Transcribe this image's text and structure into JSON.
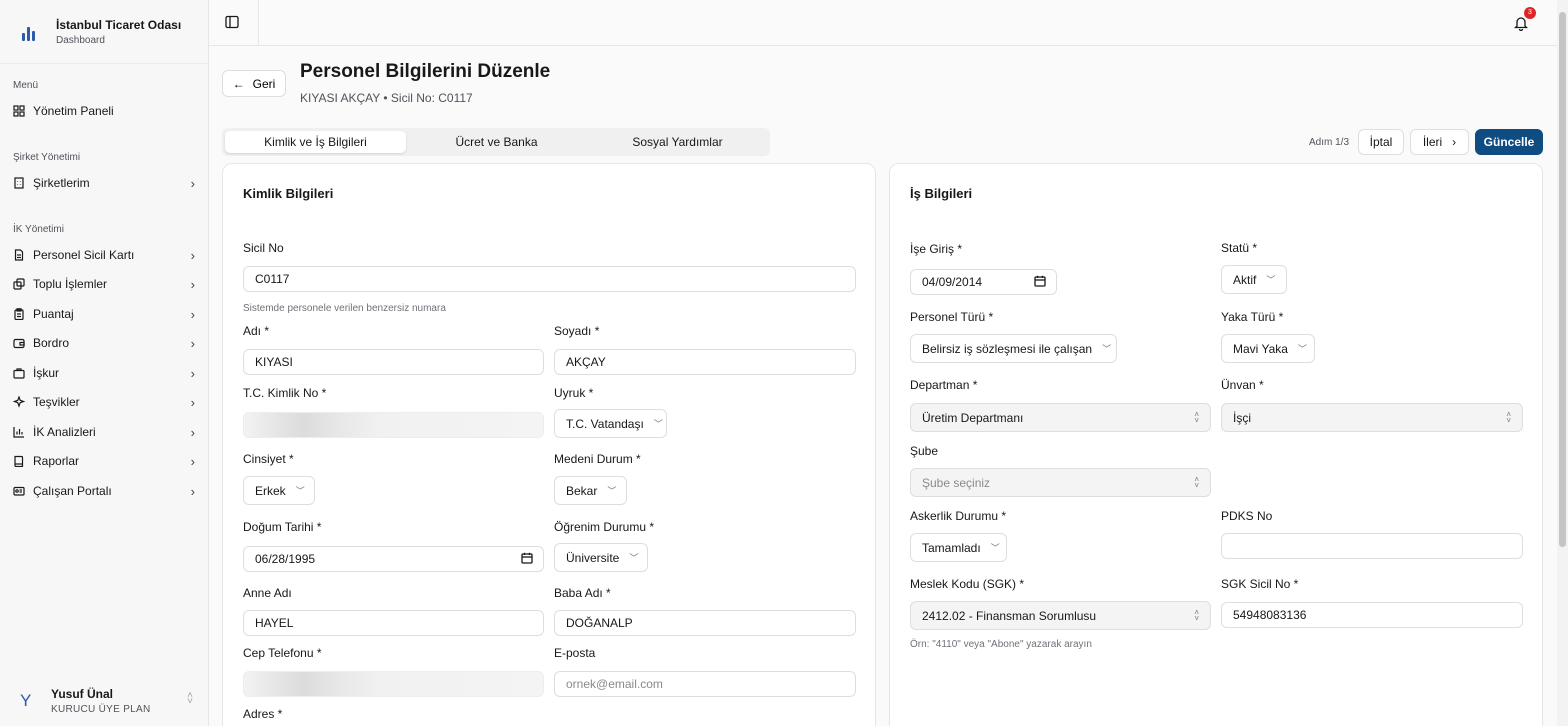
{
  "brand": {
    "title": "İstanbul Ticaret Odası",
    "subtitle": "Dashboard"
  },
  "sidebar": {
    "sections": [
      {
        "label": "Menü"
      },
      {
        "label": "Şirket Yönetimi"
      },
      {
        "label": "İK Yönetimi"
      }
    ],
    "items": [
      {
        "label": "Yönetim Paneli",
        "icon": "grid-icon"
      },
      {
        "label": "Şirketlerim",
        "icon": "building-icon"
      },
      {
        "label": "Personel Sicil Kartı",
        "icon": "document-icon"
      },
      {
        "label": "Toplu İşlemler",
        "icon": "copy-icon"
      },
      {
        "label": "Puantaj",
        "icon": "clipboard-icon"
      },
      {
        "label": "Bordro",
        "icon": "wallet-icon"
      },
      {
        "label": "İşkur",
        "icon": "briefcase-icon"
      },
      {
        "label": "Teşvikler",
        "icon": "sparkle-icon"
      },
      {
        "label": "İK Analizleri",
        "icon": "chart-icon"
      },
      {
        "label": "Raporlar",
        "icon": "book-icon"
      },
      {
        "label": "Çalışan Portalı",
        "icon": "id-card-icon"
      }
    ]
  },
  "user": {
    "initial": "Y",
    "name": "Yusuf Ünal",
    "plan": "KURUCU ÜYE PLAN"
  },
  "topbar": {
    "notification_count": "3"
  },
  "header": {
    "back_label": "Geri",
    "title": "Personel Bilgilerini Düzenle",
    "subtitle": "KIYASI AKÇAY • Sicil No: C0117"
  },
  "tabs": [
    {
      "label": "Kimlik ve İş Bilgileri",
      "active": true
    },
    {
      "label": "Ücret ve Banka",
      "active": false
    },
    {
      "label": "Sosyal Yardımlar",
      "active": false
    }
  ],
  "actions": {
    "step": "Adım 1/3",
    "cancel": "İptal",
    "next": "İleri",
    "update": "Güncelle"
  },
  "identity": {
    "title": "Kimlik Bilgileri",
    "sicil_label": "Sicil No",
    "sicil_value": "C0117",
    "sicil_hint": "Sistemde personele verilen benzersiz numara",
    "ad_label": "Adı *",
    "ad_value": "KIYASI",
    "soyad_label": "Soyadı *",
    "soyad_value": "AKÇAY",
    "tc_label": "T.C. Kimlik No *",
    "uyruk_label": "Uyruk *",
    "uyruk_value": "T.C. Vatandaşı",
    "cinsiyet_label": "Cinsiyet *",
    "cinsiyet_value": "Erkek",
    "medeni_label": "Medeni Durum *",
    "medeni_value": "Bekar",
    "dogum_label": "Doğum Tarihi *",
    "dogum_value": "06/28/1995",
    "ogrenim_label": "Öğrenim Durumu *",
    "ogrenim_value": "Üniversite",
    "anne_label": "Anne Adı",
    "anne_value": "HAYEL",
    "baba_label": "Baba Adı *",
    "baba_value": "DOĞANALP",
    "telefon_label": "Cep Telefonu *",
    "eposta_label": "E-posta",
    "eposta_placeholder": "ornek@email.com",
    "adres_label": "Adres *"
  },
  "work": {
    "title": "İş Bilgileri",
    "giris_label": "İşe Giriş *",
    "giris_value": "04/09/2014",
    "statu_label": "Statü *",
    "statu_value": "Aktif",
    "personel_turu_label": "Personel Türü *",
    "personel_turu_value": "Belirsiz iş sözleşmesi ile çalışan",
    "yaka_label": "Yaka Türü *",
    "yaka_value": "Mavi Yaka",
    "departman_label": "Departman *",
    "departman_value": "Üretim Departmanı",
    "unvan_label": "Ünvan *",
    "unvan_value": "İşçi",
    "sube_label": "Şube",
    "sube_placeholder": "Şube seçiniz",
    "askerlik_label": "Askerlik Durumu *",
    "askerlik_value": "Tamamladı",
    "pdks_label": "PDKS No",
    "pdks_value": "",
    "meslek_label": "Meslek Kodu (SGK) *",
    "meslek_value": "2412.02 - Finansman Sorumlusu",
    "meslek_hint": "Örn: \"4110\" veya \"Abone\" yazarak arayın",
    "sgk_label": "SGK Sicil No *",
    "sgk_value": "54948083136"
  },
  "colors": {
    "primary": "#0f4c81",
    "badge": "#dc2626",
    "brand_icon": "#2f5aa8"
  }
}
